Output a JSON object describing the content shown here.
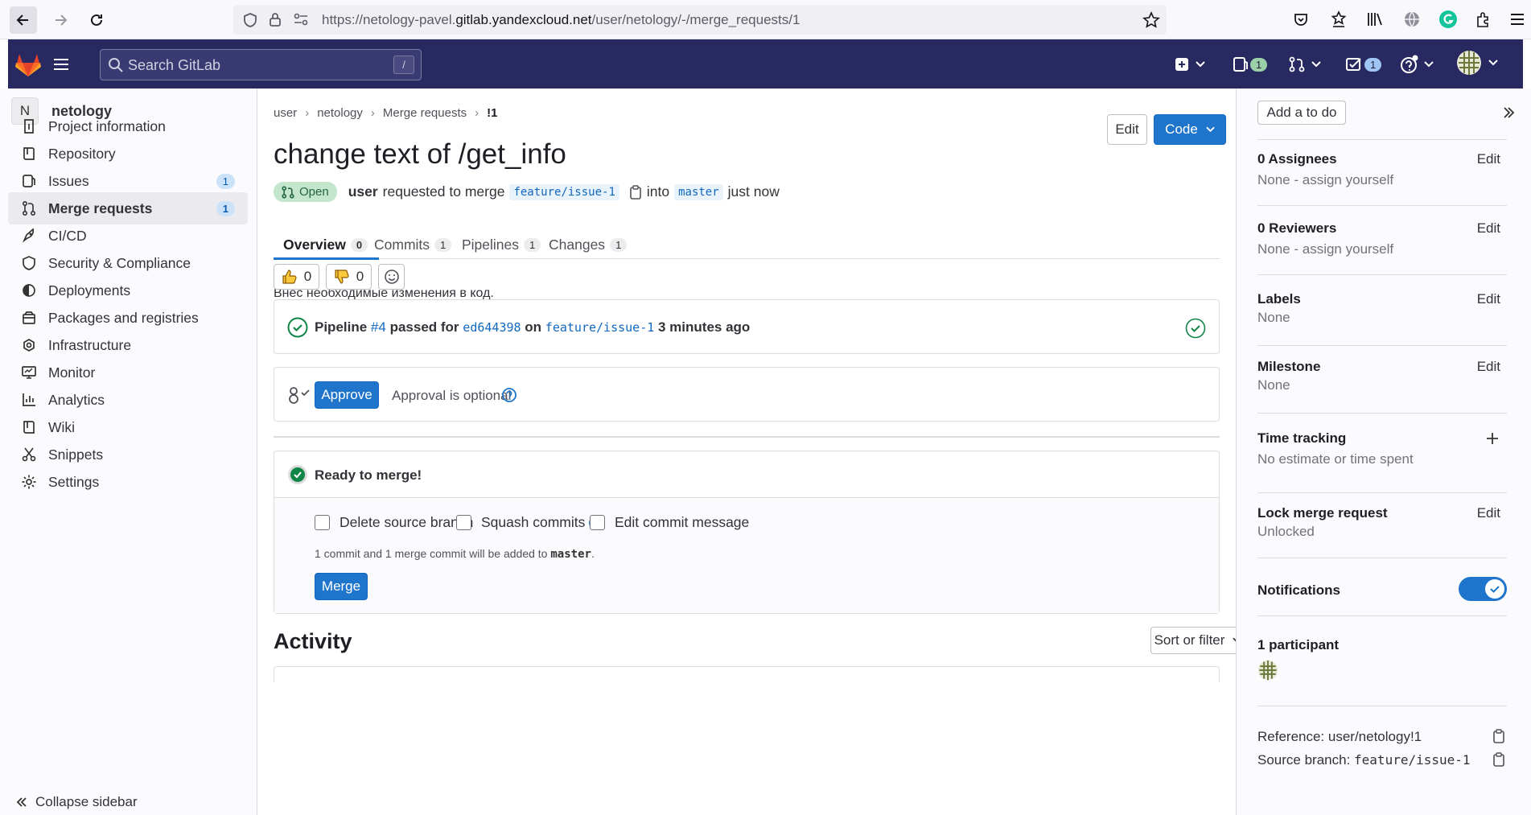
{
  "browser": {
    "url_prefix": "https://netology-pavel.",
    "url_host": "gitlab.yandexcloud.net",
    "url_path": "/user/netology/-/merge_requests/1"
  },
  "nav": {
    "search_placeholder": "Search GitLab",
    "search_kbd": "/",
    "issues_count": "1",
    "mr_count": "1",
    "todo_count": "1"
  },
  "sidebar": {
    "project_initial": "N",
    "project_name": "netology",
    "items": [
      {
        "label": "Project information",
        "icon": "info-icon"
      },
      {
        "label": "Repository",
        "icon": "book-icon"
      },
      {
        "label": "Issues",
        "icon": "issues-icon",
        "count": "1"
      },
      {
        "label": "Merge requests",
        "icon": "merge-request-icon",
        "count": "1"
      },
      {
        "label": "CI/CD",
        "icon": "rocket-icon"
      },
      {
        "label": "Security & Compliance",
        "icon": "shield-icon"
      },
      {
        "label": "Deployments",
        "icon": "deployments-icon"
      },
      {
        "label": "Packages and registries",
        "icon": "package-icon"
      },
      {
        "label": "Infrastructure",
        "icon": "cloud-icon"
      },
      {
        "label": "Monitor",
        "icon": "monitor-icon"
      },
      {
        "label": "Analytics",
        "icon": "chart-icon"
      },
      {
        "label": "Wiki",
        "icon": "book-icon"
      },
      {
        "label": "Snippets",
        "icon": "scissors-icon"
      },
      {
        "label": "Settings",
        "icon": "gear-icon"
      }
    ],
    "collapse": "Collapse sidebar"
  },
  "breadcrumbs": [
    "user",
    "netology",
    "Merge requests",
    "!1"
  ],
  "mr": {
    "title": "change text of /get_info",
    "edit": "Edit",
    "code": "Code",
    "status": "Open",
    "author": "user",
    "requested": "requested to merge",
    "source": "feature/issue-1",
    "into": "into",
    "target": "master",
    "time": "just now",
    "description": "Внёс необходимые изменения в код.",
    "thumbs_up": "0",
    "thumbs_down": "0"
  },
  "tabs": [
    {
      "label": "Overview",
      "count": "0"
    },
    {
      "label": "Commits",
      "count": "1"
    },
    {
      "label": "Pipelines",
      "count": "1"
    },
    {
      "label": "Changes",
      "count": "1"
    }
  ],
  "pipeline": {
    "prefix": "Pipeline",
    "id": "#4",
    "passed": "passed for",
    "commit": "ed644398",
    "on": "on",
    "branch": "feature/issue-1",
    "time": "3 minutes ago"
  },
  "approval": {
    "button": "Approve",
    "text": "Approval is optional"
  },
  "merge": {
    "ready": "Ready to merge!",
    "delete_source": "Delete source branch",
    "squash": "Squash commits",
    "edit_message": "Edit commit message",
    "info_prefix": "1 commit and 1 merge commit will be added to",
    "info_branch": "master",
    "info_suffix": ".",
    "button": "Merge"
  },
  "activity": {
    "title": "Activity",
    "sort": "Sort or filter"
  },
  "right": {
    "add_todo": "Add a to do",
    "assignees_title": "0 Assignees",
    "assignees_value": "None - assign yourself",
    "reviewers_title": "0 Reviewers",
    "reviewers_value": "None - assign yourself",
    "labels_title": "Labels",
    "labels_value": "None",
    "milestone_title": "Milestone",
    "milestone_value": "None",
    "time_title": "Time tracking",
    "time_value": "No estimate or time spent",
    "lock_title": "Lock merge request",
    "lock_value": "Unlocked",
    "notifications": "Notifications",
    "notifications_on": true,
    "participants": "1 participant",
    "reference": "Reference: user/netology!1",
    "source_label": "Source branch:",
    "source_value": "feature/issue-1",
    "edit": "Edit"
  },
  "colors": {
    "nav_bg": "#292961",
    "primary": "#1f75cb",
    "success": "#108548"
  }
}
